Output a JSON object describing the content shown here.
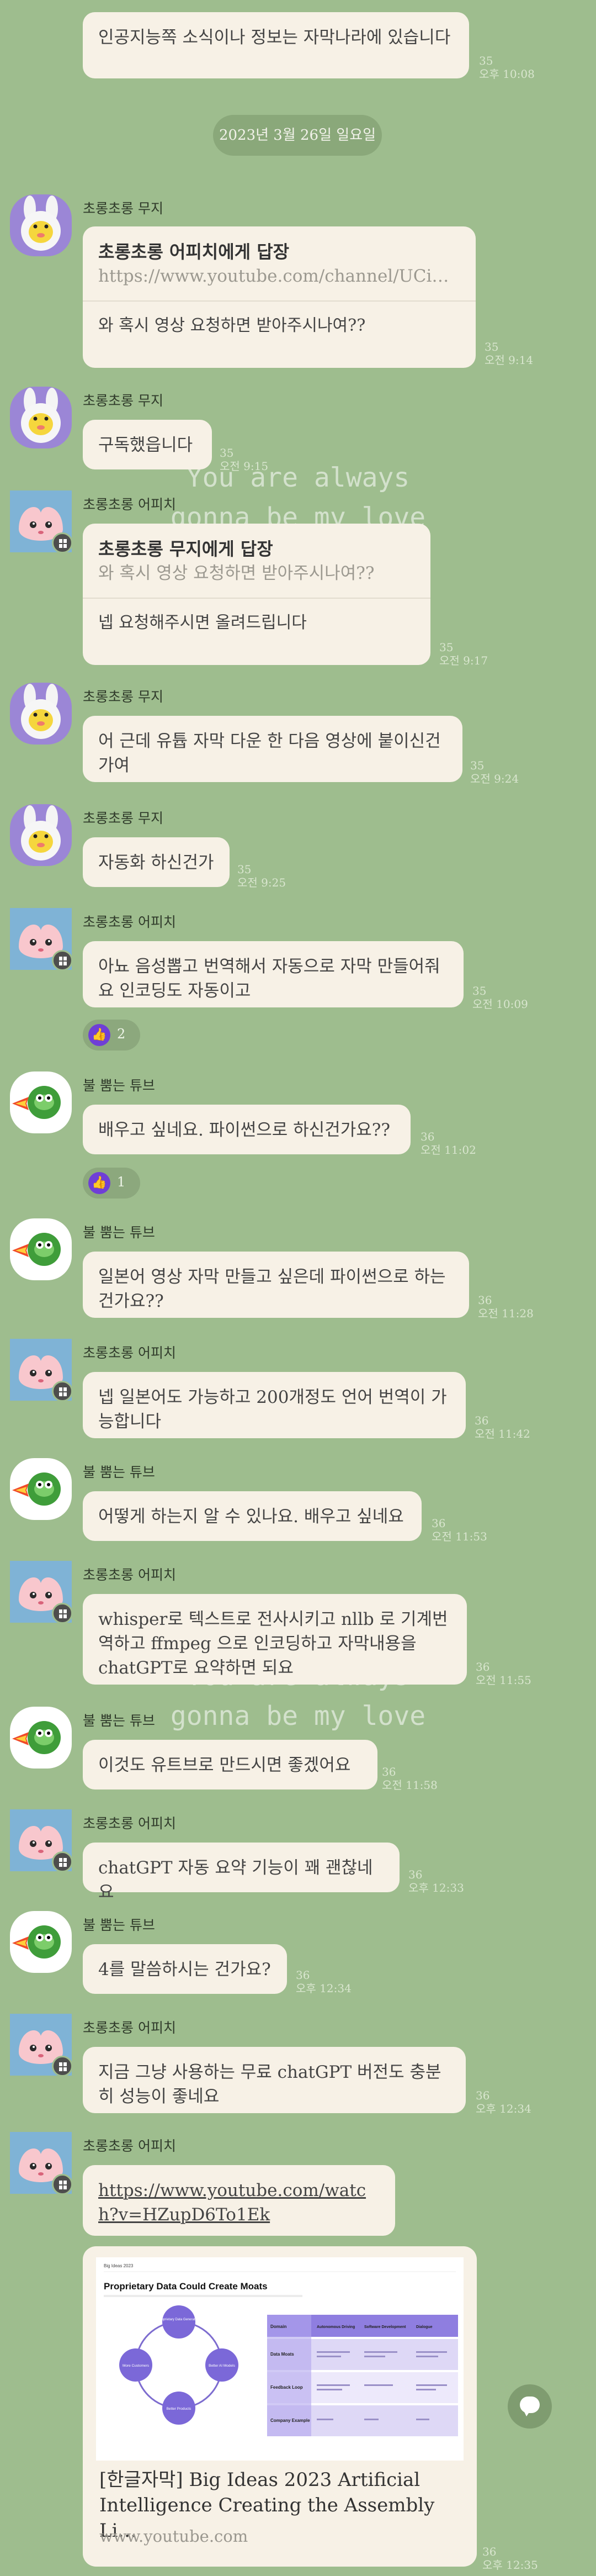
{
  "watermark": {
    "line1": "You are always",
    "line2": "gonna be my love"
  },
  "date_divider": "2023년 3월 26일 일요일",
  "messages": [
    {
      "text": "인공지능쪽 소식이나 정보는 자막나라에 있습니다",
      "unread": "35",
      "time": "오후 10:08"
    },
    {
      "sender": "초롱초롱 무지",
      "reply_title": "초롱초롱 어피치에게 답장",
      "reply_preview": "https://www.youtube.com/channel/UCi…",
      "text": "와 혹시 영상 요청하면 받아주시나여??",
      "unread": "35",
      "time": "오전 9:14"
    },
    {
      "sender": "초롱초롱 무지",
      "text": "구독했읍니다",
      "unread": "35",
      "time": "오전 9:15"
    },
    {
      "sender": "초롱초롱 어피치",
      "reply_title": "초롱초롱 무지에게 답장",
      "reply_preview": "와 혹시 영상 요청하면 받아주시나여??",
      "text": "넵 요청해주시면 올려드립니다",
      "unread": "35",
      "time": "오전 9:17"
    },
    {
      "sender": "초롱초롱 무지",
      "text": "어 근데 유튭 자막 다운 한 다음 영상에 붙이신건가여",
      "unread": "35",
      "time": "오전 9:24"
    },
    {
      "sender": "초롱초롱 무지",
      "text": "자동화 하신건가",
      "unread": "35",
      "time": "오전 9:25"
    },
    {
      "sender": "초롱초롱 어피치",
      "text": "아뇨 음성뽑고 번역해서 자동으로 자막 만들어줘요 인코딩도 자동이고",
      "unread": "35",
      "time": "오전 10:09",
      "reaction": "2"
    },
    {
      "sender": "불 뿜는 튜브",
      "text": "배우고 싶네요. 파이썬으로 하신건가요??",
      "unread": "36",
      "time": "오전 11:02",
      "reaction": "1"
    },
    {
      "sender": "불 뿜는 튜브",
      "text": "일본어 영상 자막 만들고 싶은데 파이썬으로 하는 건가요??",
      "unread": "36",
      "time": "오전 11:28"
    },
    {
      "sender": "초롱초롱 어피치",
      "text": "넵 일본어도 가능하고 200개정도 언어 번역이 가능합니다",
      "unread": "36",
      "time": "오전 11:42"
    },
    {
      "sender": "불 뿜는 튜브",
      "text": "어떻게 하는지 알 수 있나요. 배우고 싶네요",
      "unread": "36",
      "time": "오전 11:53"
    },
    {
      "sender": "초롱초롱 어피치",
      "text": "whisper로 텍스트로 전사시키고 nllb 로 기계번역하고 ffmpeg 으로 인코딩하고 자막내용을 chatGPT로 요약하면 되요",
      "unread": "36",
      "time": "오전 11:55"
    },
    {
      "sender": "불 뿜는 튜브",
      "text": "이것도 유트브로 만드시면 좋겠어요",
      "unread": "36",
      "time": "오전 11:58"
    },
    {
      "sender": "초롱초롱 어피치",
      "text": "chatGPT 자동 요약 기능이 꽤 괜찮네요",
      "unread": "36",
      "time": "오후 12:33"
    },
    {
      "sender": "불 뿜는 튜브",
      "text": "4를 말씀하시는 건가요?",
      "unread": "36",
      "time": "오후 12:34"
    },
    {
      "sender": "초롱초롱 어피치",
      "text": "지금 그냥 사용하는 무료 chatGPT 버전도 충분히 성능이 좋네요",
      "unread": "36",
      "time": "오후 12:34"
    },
    {
      "sender": "초롱초롱 어피치",
      "link": "https://www.youtube.com/watch?v=HZupD6To1Ek"
    }
  ],
  "link_card": {
    "thumb_title": "Proprietary Data Could Create Moats",
    "thumb_header_left": "Big Ideas 2023",
    "cycle_labels": [
      "Proprietary Data Generation",
      "Better AI Models",
      "Better Products",
      "More Customers"
    ],
    "table_headers": [
      "Domain",
      "Autonomous Driving",
      "Software Development",
      "Dialogue"
    ],
    "table_rows": [
      "Data Moats",
      "Feedback Loop",
      "Company Example"
    ],
    "title": "[한글자막] Big Ideas 2023 Artificial Intelligence Creating the Assembly Li…",
    "domain": "www.youtube.com",
    "unread": "36",
    "time": "오후 12:35"
  },
  "colors": {
    "background": "#9ebd8e",
    "bubble": "#f7f1e6",
    "reaction": "#6f3fd6"
  },
  "icons": {
    "reaction": "thumbs-up-icon",
    "fab": "chat-bubble-icon",
    "avatar_badge": "grid-icon"
  }
}
